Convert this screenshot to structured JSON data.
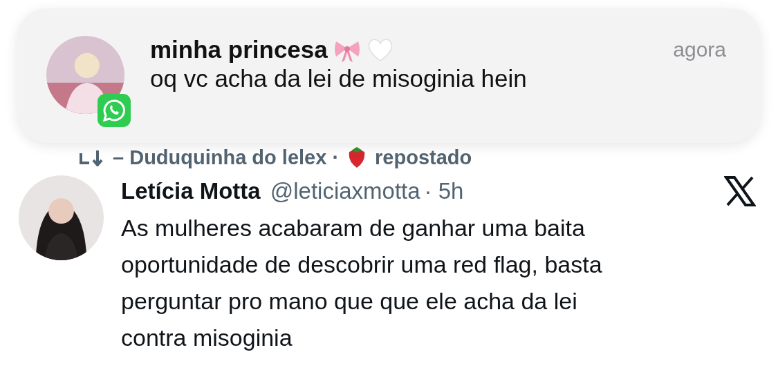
{
  "notification": {
    "title": "minha princesa",
    "time": "agora",
    "message": "oq vc acha da lei de misoginia hein"
  },
  "tweet": {
    "repost": {
      "by": "– Duduquinha do lelex ·",
      "label": "repostado"
    },
    "author": {
      "name": "Letícia Motta",
      "handle": "@leticiaxmotta",
      "time": "· 5h"
    },
    "text_lines": [
      "As mulheres acabaram de ganhar uma baita",
      "oportunidade de descobrir uma red flag, basta",
      "perguntar pro mano que que ele acha da lei",
      "contra misoginia"
    ]
  }
}
